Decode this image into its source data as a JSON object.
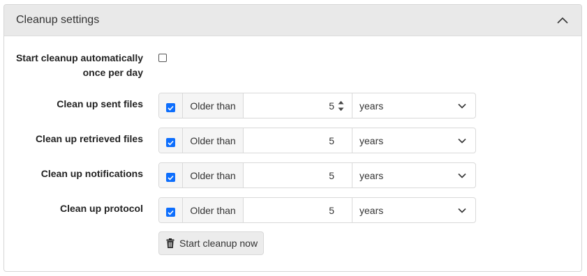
{
  "panel": {
    "title": "Cleanup settings",
    "collapse_icon": "chevron-up-icon"
  },
  "auto_cleanup": {
    "label_line1": "Start cleanup automatically",
    "label_line2": "once per day",
    "checked": false
  },
  "rows": [
    {
      "label": "Clean up sent files",
      "checked": true,
      "prefix": "Older than",
      "value": "5",
      "unit": "years"
    },
    {
      "label": "Clean up retrieved files",
      "checked": true,
      "prefix": "Older than",
      "value": "5",
      "unit": "years"
    },
    {
      "label": "Clean up notifications",
      "checked": true,
      "prefix": "Older than",
      "value": "5",
      "unit": "years"
    },
    {
      "label": "Clean up protocol",
      "checked": true,
      "prefix": "Older than",
      "value": "5",
      "unit": "years"
    }
  ],
  "actions": {
    "start_cleanup_label": "Start cleanup now",
    "start_cleanup_icon": "trash-icon"
  },
  "colors": {
    "accent": "#0d6efd",
    "header_bg": "#e9e9e9"
  }
}
